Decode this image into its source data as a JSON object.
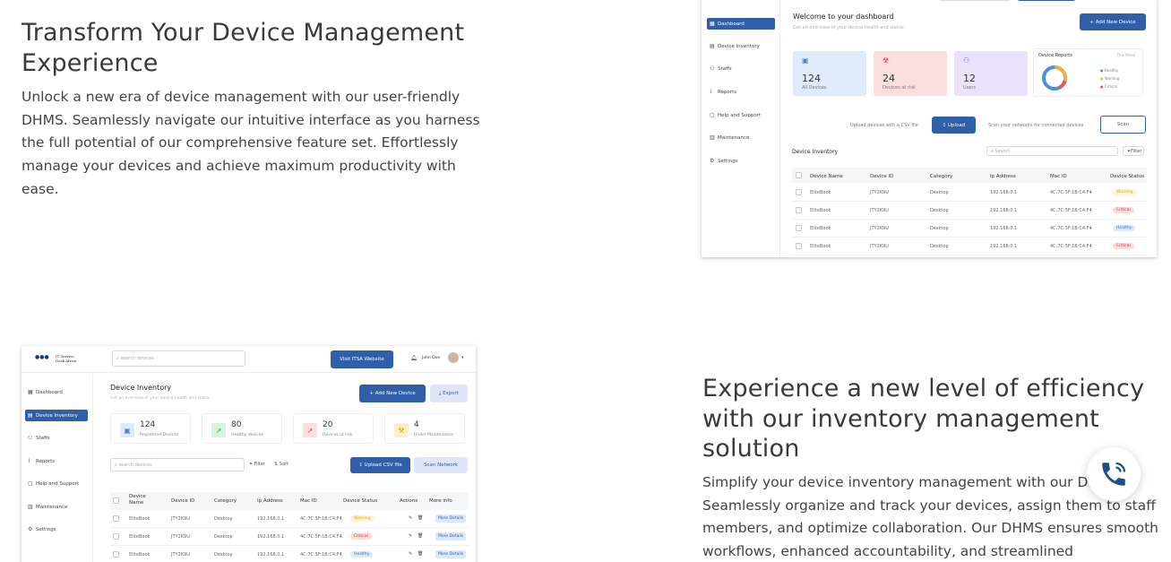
{
  "section1": {
    "heading": "Transform Your Device Management Experience",
    "paragraph": "Unlock a new era of device management with our user-friendly DHMS. Seamlessly navigate our intuitive interface as you harness the full potential of our comprehensive feature set. Effortlessly manage your devices and achieve maximum productivity with ease."
  },
  "section2": {
    "heading": "Experience a new level of efficiency with our inventory management solution",
    "paragraph": "Simplify your device inventory management with our DHMS. Seamlessly organize and track your devices, assign them to staff members, and optimize collaboration. Our DHMS ensures smooth workflows, enhanced accountability, and streamlined"
  },
  "dashboard_shot": {
    "sidebar": [
      "Dashboard",
      "Device Inventory",
      "Staffs",
      "Reports",
      "Help and Support",
      "Maintenance",
      "Settings"
    ],
    "title": "Welcome to your dashboard",
    "subtitle": "Get an overview of your device health and status",
    "add_button": "+ Add New Device",
    "cards": [
      {
        "value": "124",
        "label": "All Devices"
      },
      {
        "value": "24",
        "label": "Devices at risk"
      },
      {
        "value": "12",
        "label": "Users"
      }
    ],
    "reports": {
      "title": "Device Reports",
      "filter": "This Week",
      "legend": [
        "Healthy",
        "Warning",
        "Critical"
      ]
    },
    "upload_label": "Upload devices with a CSV file",
    "upload_button": "Upload",
    "scan_label": "Scan your networks for connected devices",
    "scan_button": "Scan",
    "inventory_title": "Device Inventory",
    "search_placeholder": "Search",
    "filter_button": "Filter",
    "columns": [
      "Device Name",
      "Device ID",
      "Category",
      "Ip Address",
      "Mac ID",
      "Device Status"
    ],
    "rows": [
      {
        "name": "EliteBook",
        "id": "JTY2K9U",
        "cat": "Desktop",
        "ip": "192.168.0.1",
        "mac": "4C:7C:5F:1B:C4:F4",
        "status": "Warning"
      },
      {
        "name": "EliteBook",
        "id": "JTY2K9U",
        "cat": "Desktop",
        "ip": "192.168.0.1",
        "mac": "4C:7C:5F:1B:C4:F4",
        "status": "Critical"
      },
      {
        "name": "EliteBook",
        "id": "JTY2K9U",
        "cat": "Desktop",
        "ip": "192.168.0.1",
        "mac": "4C:7C:5F:1B:C4:F4",
        "status": "Healthy"
      },
      {
        "name": "EliteBook",
        "id": "JTY2K9U",
        "cat": "Desktop",
        "ip": "192.168.0.1",
        "mac": "4C:7C:5F:1B:C4:F4",
        "status": "Critical"
      }
    ]
  },
  "inventory_shot": {
    "brand": "IT Service Desk Africa",
    "search_placeholder": "search devices",
    "visit_button": "Visit ITSA Website",
    "user": "John Doe",
    "sidebar": [
      "Dashboard",
      "Device Inventory",
      "Staffs",
      "Reports",
      "Help and Support",
      "Maintenance",
      "Settings"
    ],
    "title": "Device Inventory",
    "subtitle": "Get an overview of your device health and status",
    "add_button": "+ Add New Device",
    "export_button": "Export",
    "cards": [
      {
        "value": "124",
        "label": "Registered Devices"
      },
      {
        "value": "80",
        "label": "Healthy devices"
      },
      {
        "value": "20",
        "label": "Devices at risk"
      },
      {
        "value": "4",
        "label": "Under Maintenance"
      }
    ],
    "search2_placeholder": "search devices",
    "filter": "Filter",
    "sort": "Sort",
    "upload_button": "Upload CSV file",
    "scan_button": "Scan Network",
    "columns": [
      "Device Name",
      "Device ID",
      "Category",
      "Ip Address",
      "Mac ID",
      "Device Status",
      "Actions",
      "More info"
    ],
    "rows": [
      {
        "name": "EliteBook",
        "id": "JTY2K9U",
        "cat": "Desktop",
        "ip": "192.168.0.1",
        "mac": "4C:7C:5F:1B:C4:F4",
        "status": "Warning",
        "more": "More Details"
      },
      {
        "name": "EliteBook",
        "id": "JTY2K9U",
        "cat": "Desktop",
        "ip": "192.168.0.1",
        "mac": "4C:7C:5F:1B:C4:F4",
        "status": "Critical",
        "more": "More Details"
      },
      {
        "name": "EliteBook",
        "id": "JTY2K9U",
        "cat": "Desktop",
        "ip": "192.168.0.1",
        "mac": "4C:7C:5F:1B:C4:F4",
        "status": "Healthy",
        "more": "More Details"
      }
    ]
  },
  "icons": {
    "phone": "phone-icon"
  },
  "colors": {
    "primary": "#2f5fa8",
    "text": "#3a3a3a"
  }
}
